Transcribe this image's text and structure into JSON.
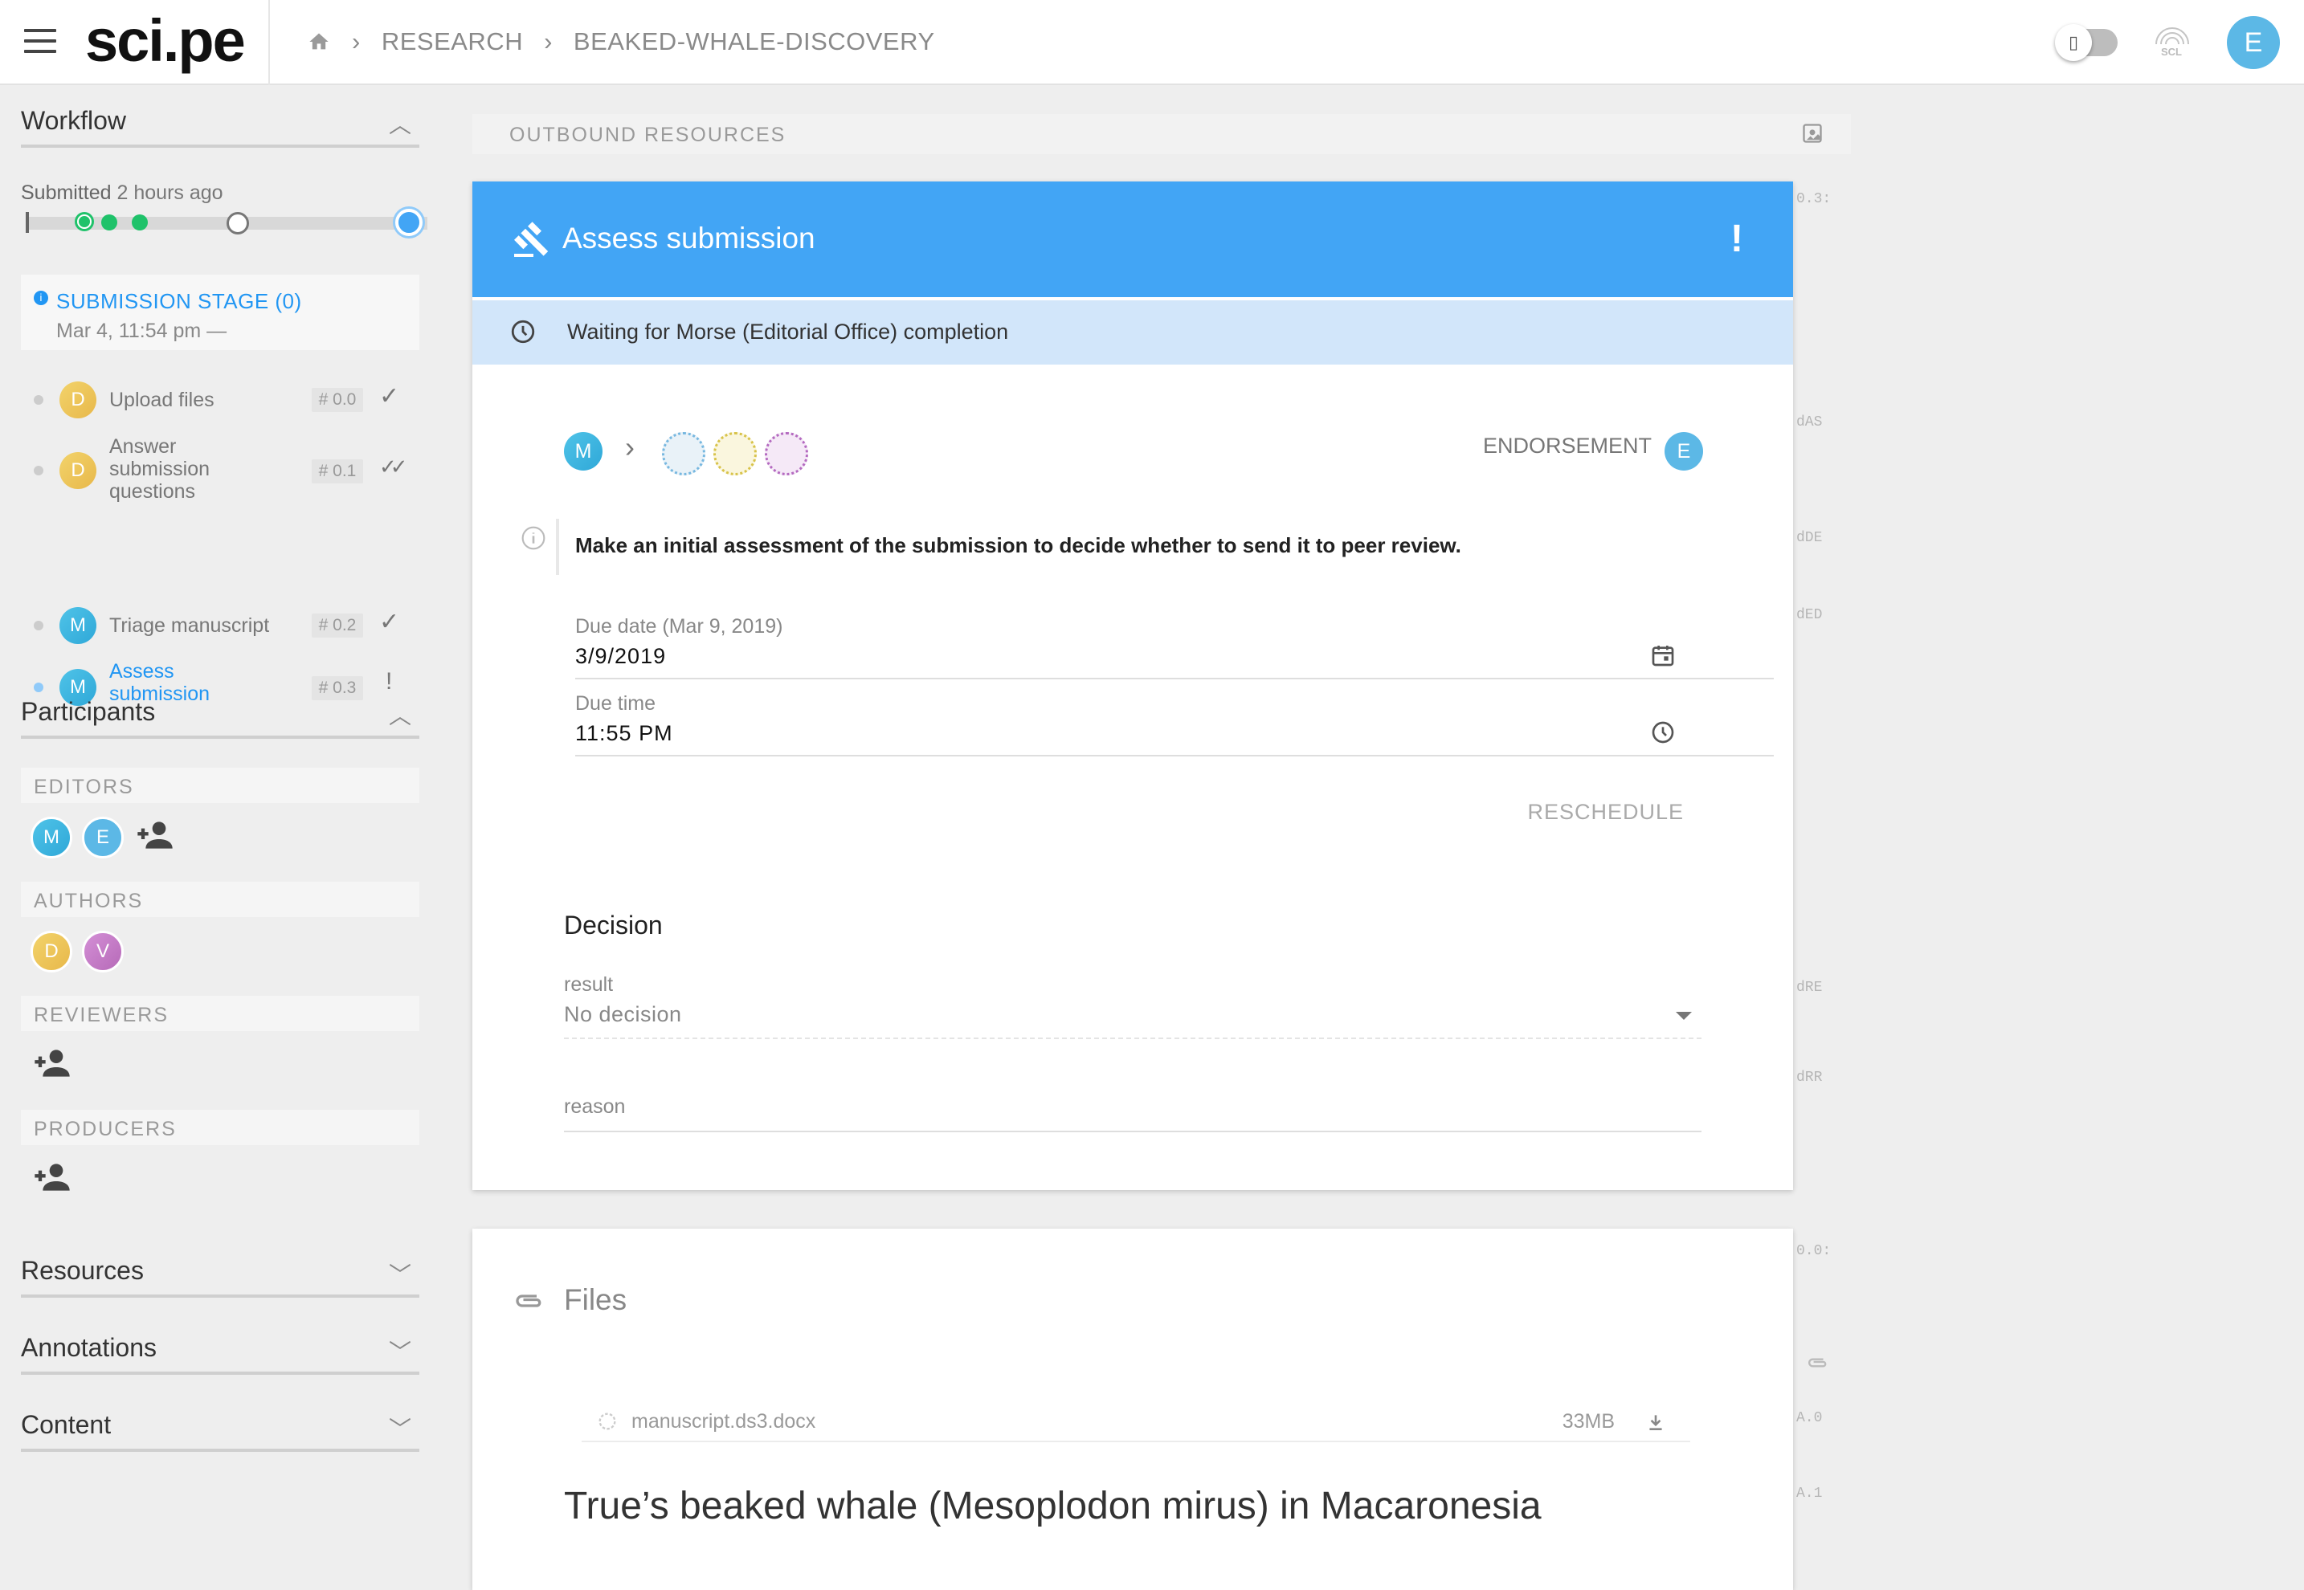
{
  "header": {
    "logo": "sci.pe",
    "breadcrumb": [
      "RESEARCH",
      "BEAKED-WHALE-DISCOVERY"
    ],
    "scl_label": "SCL",
    "user_initial": "E",
    "icons": [
      "menu-icon",
      "home-icon",
      "toggle-switch",
      "fingerprint-icon"
    ]
  },
  "sidebar": {
    "workflow_title": "Workflow",
    "submitted_label": "Submitted",
    "submitted_ago": "2 hours ago",
    "stage": {
      "title": "SUBMISSION STAGE (0)",
      "date": "Mar 4, 11:54 pm —"
    },
    "tasks": [
      {
        "avatar": "D",
        "name": "Upload files",
        "tag": "# 0.0",
        "status": "✓",
        "active": false
      },
      {
        "avatar": "D",
        "name": "Answer submission questions",
        "tag": "# 0.1",
        "status": "✓✓",
        "active": false
      },
      {
        "avatar": "M",
        "name": "Triage manuscript",
        "tag": "# 0.2",
        "status": "✓",
        "active": false
      },
      {
        "avatar": "M",
        "name": "Assess submission",
        "tag": "# 0.3",
        "status": "!",
        "active": true
      }
    ],
    "participants_title": "Participants",
    "roles": {
      "editors": {
        "label": "EDITORS",
        "members": [
          "M",
          "E"
        ]
      },
      "authors": {
        "label": "AUTHORS",
        "members": [
          "D",
          "V"
        ]
      },
      "reviewers": {
        "label": "REVIEWERS",
        "members": []
      },
      "producers": {
        "label": "PRODUCERS",
        "members": []
      }
    },
    "resources_title": "Resources",
    "annotations_title": "Annotations",
    "content_title": "Content"
  },
  "main": {
    "outbound_label": "OUTBOUND RESOURCES",
    "action": {
      "title": "Assess submission",
      "flag": "!",
      "waiting_text": "Waiting for Morse (Editorial Office) completion",
      "assignee_initial": "M",
      "endorsement_label": "ENDORSEMENT",
      "endorser_initial": "E",
      "description": "Make an initial assessment of the submission to decide whether to send it to peer review.",
      "due_date_label": "Due date (Mar 9, 2019)",
      "due_date_value": "3/9/2019",
      "due_time_label": "Due time",
      "due_time_value": "11:55 PM",
      "reschedule_label": "RESCHEDULE",
      "decision_title": "Decision",
      "result_label": "result",
      "result_value": "No decision",
      "reason_label": "reason"
    },
    "files": {
      "title": "Files",
      "items": [
        {
          "name": "manuscript.ds3.docx",
          "size": "33MB"
        }
      ]
    },
    "article_title": "True’s beaked whale (Mesoplodon mirus) in Macaronesia"
  },
  "rail": [
    "0.3:",
    "dAS",
    "dDE",
    "dED",
    "dRE",
    "dRR",
    "0.0:",
    "A.0",
    "A.1"
  ],
  "colors": {
    "accent": "#42a5f5",
    "waiting_bg": "#d2e6fa",
    "link_blue": "#2196f3",
    "progress_done": "#1fc26a",
    "background": "#eeeeee"
  }
}
